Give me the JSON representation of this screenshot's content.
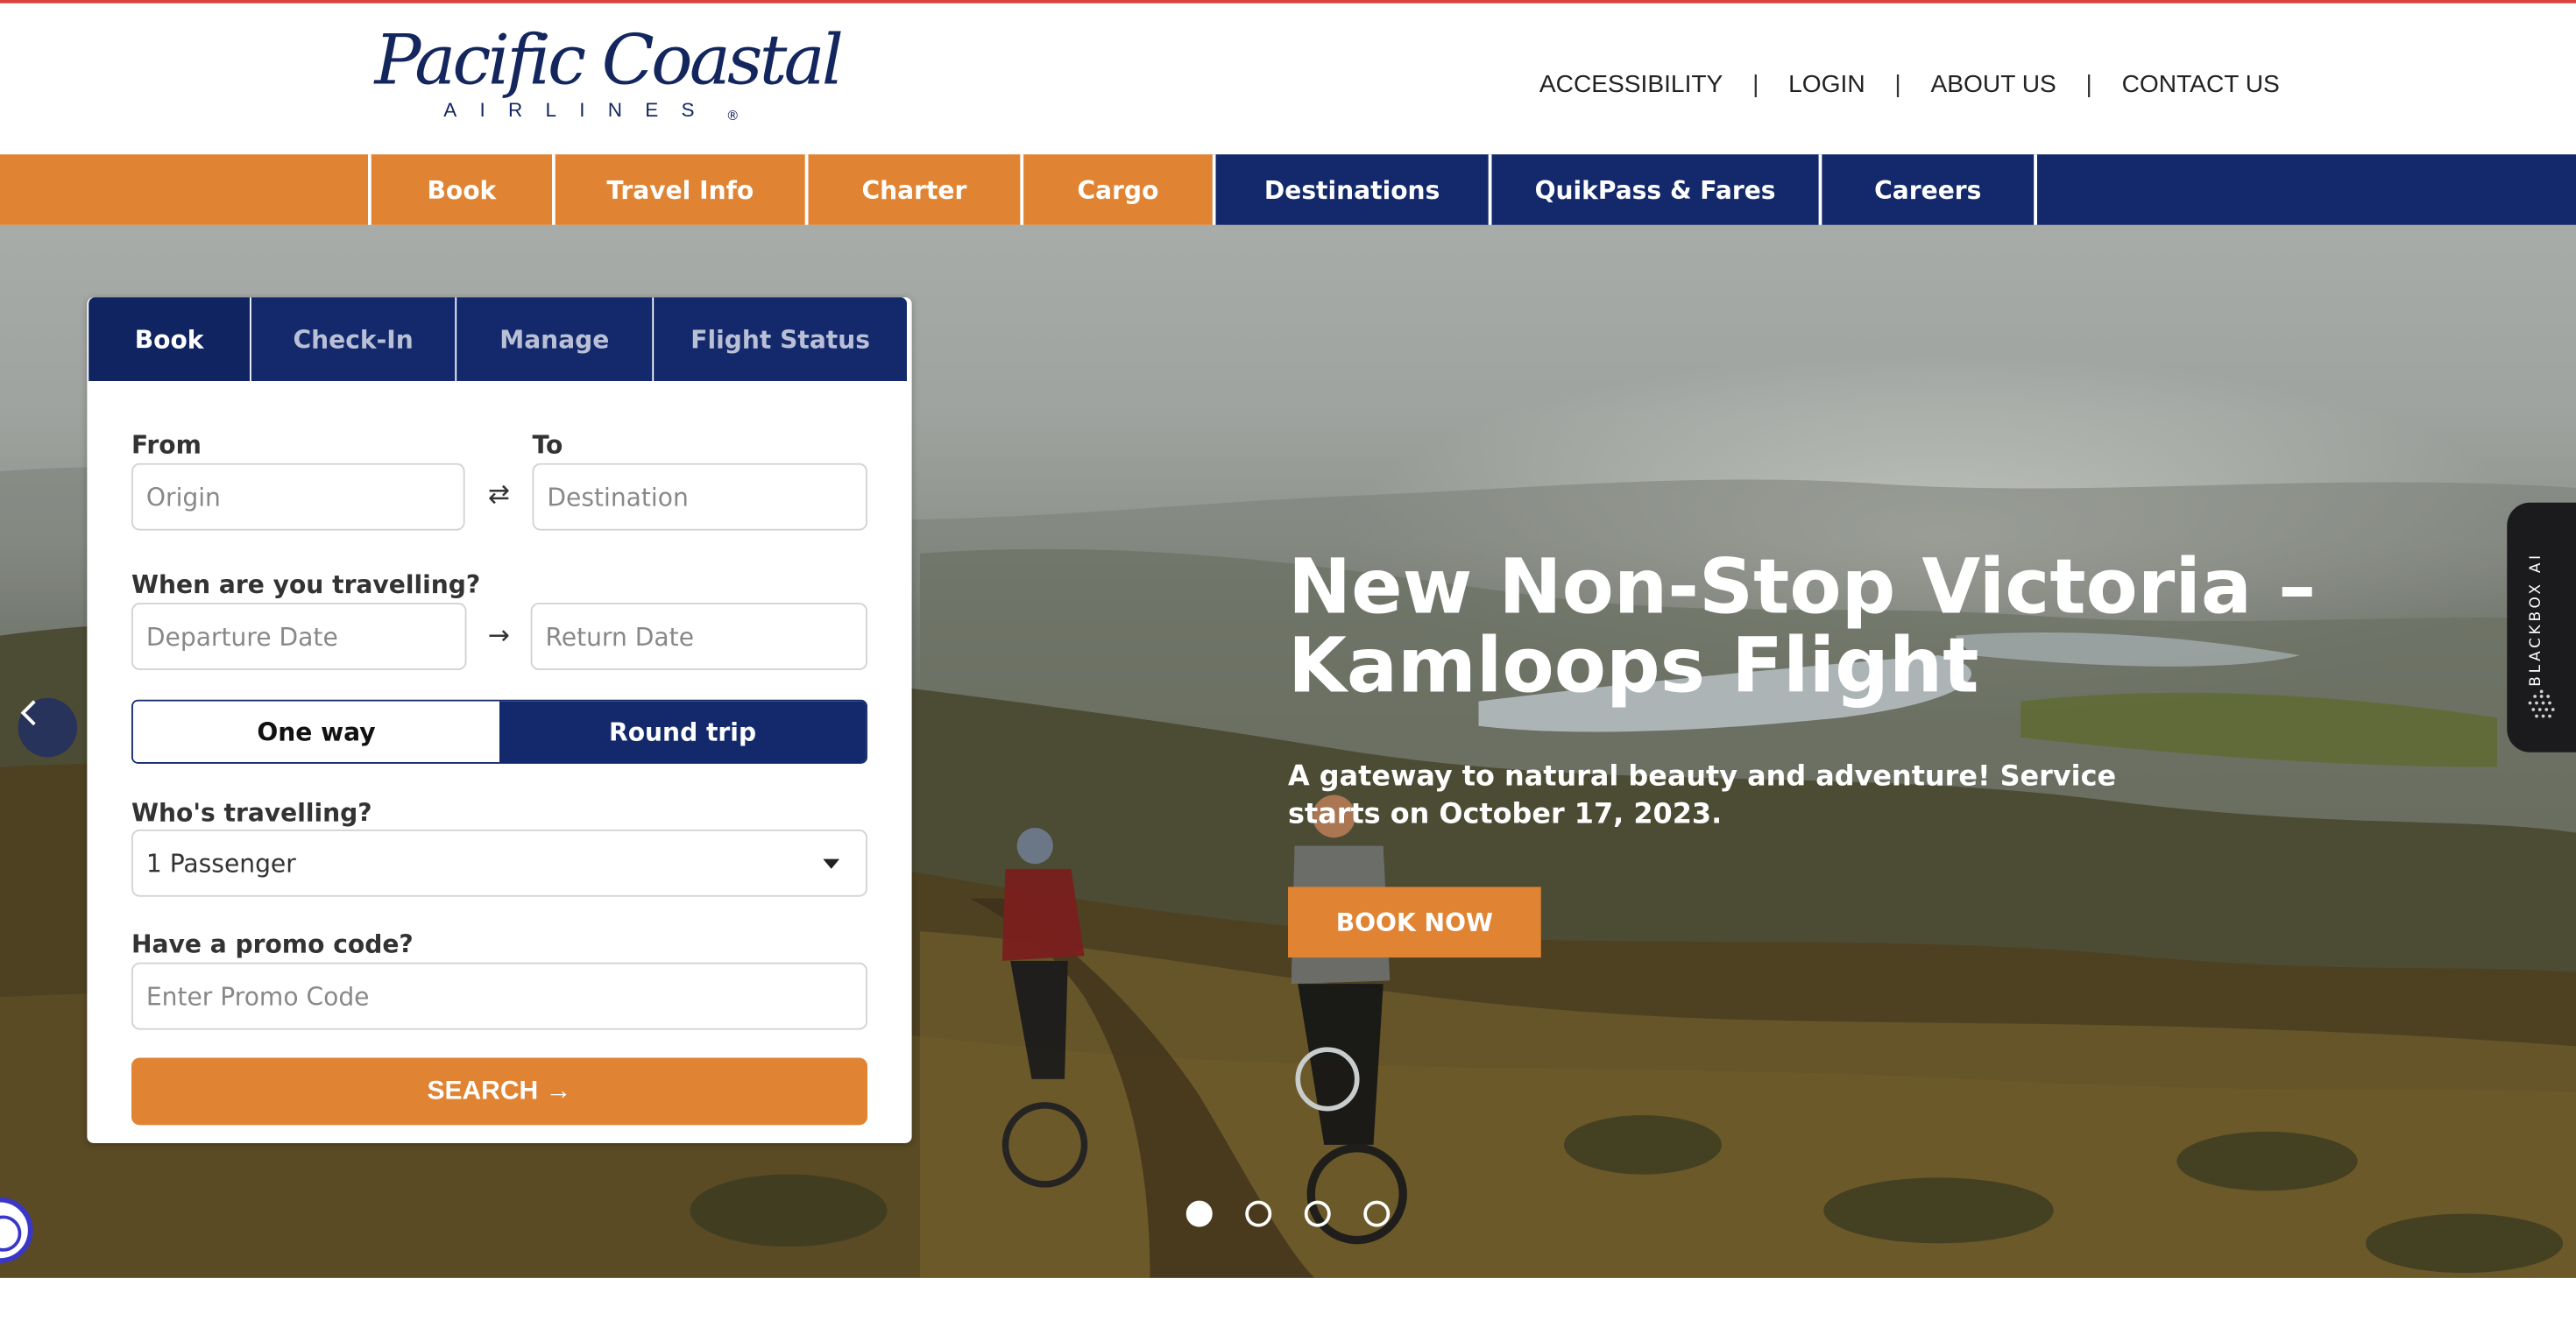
{
  "logo": {
    "brand": "Pacific Coastal",
    "sub": "AIRLINES",
    "reg": "®"
  },
  "utility_links": [
    "ACCESSIBILITY",
    "LOGIN",
    "ABOUT US",
    "CONTACT US"
  ],
  "utility_separator": "|",
  "nav": [
    {
      "label": "Book",
      "color": "#e08433"
    },
    {
      "label": "Travel Info",
      "color": "#e08433"
    },
    {
      "label": "Charter",
      "color": "#e08433"
    },
    {
      "label": "Cargo",
      "color": "#e08433"
    },
    {
      "label": "Destinations",
      "color": "#13296b"
    },
    {
      "label": "QuikPass & Fares",
      "color": "#13296b"
    },
    {
      "label": "Careers",
      "color": "#13296b"
    }
  ],
  "widget": {
    "tabs": [
      "Book",
      "Check-In",
      "Manage",
      "Flight Status"
    ],
    "active_tab": "Book",
    "from_label": "From",
    "to_label": "To",
    "origin_placeholder": "Origin",
    "destination_placeholder": "Destination",
    "swap_icon": "⇄",
    "when_label": "When are you travelling?",
    "departure_placeholder": "Departure Date",
    "return_placeholder": "Return Date",
    "date_arrow_icon": "→",
    "trip_options": [
      "One way",
      "Round trip"
    ],
    "selected_trip": "Round trip",
    "who_label": "Who's travelling?",
    "passengers_value": "1 Passenger",
    "promo_label": "Have a promo code?",
    "promo_placeholder": "Enter Promo Code",
    "search_label": "SEARCH →"
  },
  "hero": {
    "title": "New Non-Stop Victoria – Kamloops Flight",
    "subtitle": "A gateway to natural beauty and adventure! Service starts on October 17, 2023.",
    "cta": "BOOK NOW",
    "slides": 4,
    "active_slide": 1
  },
  "ai_tab": {
    "label": "BLACKBOX AI"
  },
  "colors": {
    "orange": "#e08433",
    "navy": "#13296b",
    "accent_red": "#d9443a"
  }
}
